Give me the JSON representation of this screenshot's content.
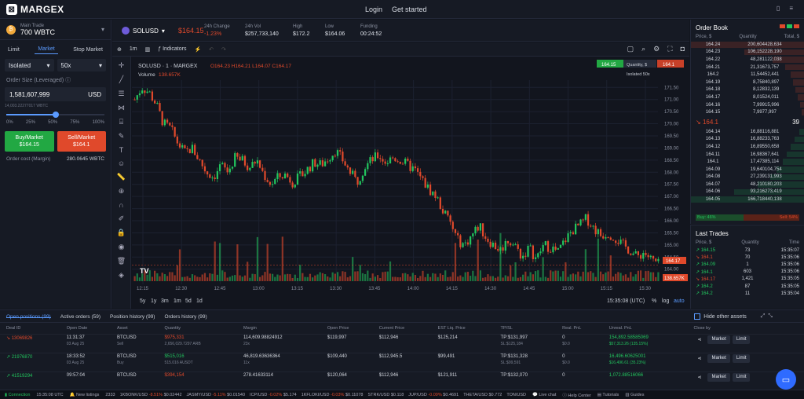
{
  "header": {
    "brand": "MARGEX",
    "login": "Login",
    "get_started": "Get started"
  },
  "account": {
    "label": "Main Trade",
    "value": "700 WBTC"
  },
  "order_form": {
    "tabs": [
      "Limit",
      "Market",
      "Stop Market"
    ],
    "active_tab": "Market",
    "margin_mode": "Isolated",
    "leverage": "50x",
    "size_label": "Order Size (Leveraged)",
    "size_value": "1,581,607,999",
    "size_unit": "USD",
    "size_sub": "14,003.22277017 WBTC",
    "slider_percent": 0.5,
    "slider_marks": [
      "0%",
      "25%",
      "50%",
      "75%",
      "100%"
    ],
    "buy_label": "Buy/Market",
    "buy_price": "$164.15",
    "sell_label": "Sell/Market",
    "sell_price": "$164.1",
    "cost_label": "Order cost (Margin)",
    "cost_value": "280.0645 WBTC"
  },
  "ticker": {
    "symbol": "SOLUSD",
    "last_price": "$164.15",
    "change_label": "24h Change",
    "change_value": "-1.23%",
    "vol_label": "24h Vol",
    "vol_value": "$257,733,140",
    "high_label": "High",
    "high_value": "$172.2",
    "low_label": "Low",
    "low_value": "$164.06",
    "funding_label": "Funding",
    "funding_value": "00:24:52"
  },
  "toolbar": {
    "interval": "1m",
    "indicators": "Indicators"
  },
  "chart_legend": {
    "title": "SOLUSD · 1 · MARGEX",
    "ohlc": "O164.23  H164.21  L164.07  C164.17",
    "volume_label": "Volume",
    "volume_value": "138.657K",
    "buy_tag": "164.15",
    "qty_tag": "Quantity, $",
    "sell_tag": "164.1",
    "isolated_tag": "Isolated 50x",
    "last_price_tag": "164.17",
    "volume_tag": "138.657K",
    "time_ranges": [
      "5y",
      "1y",
      "3m",
      "1m",
      "5d",
      "1d"
    ],
    "clock": "15:35:08 (UTC)",
    "percent": "%",
    "log": "log",
    "auto": "auto"
  },
  "chart_data": {
    "type": "candlestick",
    "x_ticks": [
      "12:15",
      "12:30",
      "12:45",
      "13:00",
      "13:15",
      "13:30",
      "13:45",
      "14:00",
      "14:15",
      "14:30",
      "14:45",
      "15:00",
      "15:15",
      "15:30"
    ],
    "y_ticks": [
      "171.50",
      "171.00",
      "170.50",
      "170.00",
      "169.50",
      "169.00",
      "168.50",
      "168.00",
      "167.50",
      "167.00",
      "166.50",
      "166.00",
      "165.50",
      "165.00",
      "164.50",
      "164.00"
    ],
    "ylim": [
      163.7,
      171.8
    ],
    "close_path": [
      171.0,
      171.5,
      171.3,
      170.8,
      170.0,
      169.8,
      169.2,
      168.8,
      169.0,
      168.5,
      168.0,
      167.8,
      168.3,
      168.0,
      168.6,
      168.5,
      168.2,
      168.5,
      167.9,
      167.5,
      167.8,
      167.9,
      167.6,
      167.8,
      168.1,
      168.4,
      168.3,
      168.6,
      168.9,
      168.5,
      168.0,
      167.6,
      168.2,
      168.5,
      168.7,
      168.4,
      168.6,
      168.5,
      168.3,
      168.1,
      167.7,
      167.3,
      167.0,
      166.4,
      165.9,
      165.2,
      165.0,
      165.4,
      165.8,
      165.3,
      165.0,
      164.8,
      165.2,
      165.0,
      164.5,
      164.9,
      164.4,
      165.0,
      164.9,
      164.7,
      165.2,
      165.6,
      165.8,
      166.1,
      165.7,
      165.4,
      165.5,
      165.3,
      165.0,
      164.8,
      164.5,
      164.7,
      164.4,
      164.2
    ]
  },
  "order_book": {
    "title": "Order Book",
    "headers": [
      "Price, $",
      "Quantity",
      "Total, $"
    ],
    "asks": [
      [
        "164.24",
        "200,604",
        "428,634"
      ],
      [
        "164.23",
        "106,152",
        "228,190"
      ],
      [
        "164.22",
        "48,281",
        "122,038"
      ],
      [
        "164.21",
        "21,316",
        "73,757"
      ],
      [
        "164.2",
        "11,544",
        "52,441"
      ],
      [
        "164.19",
        "8,758",
        "40,897"
      ],
      [
        "164.18",
        "8,128",
        "32,139"
      ],
      [
        "164.17",
        "8,015",
        "24,011"
      ],
      [
        "164.16",
        "7,999",
        "15,996"
      ],
      [
        "164.15",
        "7,997",
        "7,997"
      ]
    ],
    "ask_depth": [
      1,
      0.53,
      0.28,
      0.17,
      0.12,
      0.095,
      0.075,
      0.056,
      0.037,
      0.019
    ],
    "mid_price": "164.1",
    "mid_spread": "39",
    "bids": [
      [
        "164.14",
        "16,881",
        "16,881"
      ],
      [
        "164.13",
        "16,882",
        "33,763"
      ],
      [
        "164.12",
        "16,895",
        "50,658"
      ],
      [
        "164.11",
        "16,983",
        "67,641"
      ],
      [
        "164.1",
        "17,473",
        "85,114"
      ],
      [
        "164.09",
        "19,640",
        "104,754"
      ],
      [
        "164.08",
        "27,239",
        "131,993"
      ],
      [
        "164.07",
        "48,210",
        "180,203"
      ],
      [
        "164.06",
        "93,216",
        "273,419"
      ],
      [
        "164.05",
        "166,718",
        "440,138"
      ]
    ],
    "bid_depth": [
      0.04,
      0.08,
      0.12,
      0.15,
      0.19,
      0.24,
      0.3,
      0.41,
      0.62,
      1
    ],
    "buy_ratio": "Buy: 46%",
    "sell_ratio": "Sell: 54%",
    "buy_share": 0.46
  },
  "last_trades": {
    "title": "Last Trades",
    "headers": [
      "Price, $",
      "Quantity",
      "Time"
    ],
    "rows": [
      [
        "↗ 164.15",
        "73",
        "15:35:07",
        "up"
      ],
      [
        "↘ 164.1",
        "70",
        "15:35:06",
        "down"
      ],
      [
        "↗ 164.09",
        "1",
        "15:35:06",
        "up"
      ],
      [
        "↗ 164.1",
        "603",
        "15:35:06",
        "up"
      ],
      [
        "↘ 164.17",
        "1,421",
        "15:35:05",
        "down"
      ],
      [
        "↗ 164.2",
        "87",
        "15:35:05",
        "up"
      ],
      [
        "↗ 164.2",
        "11",
        "15:35:04",
        "up"
      ]
    ]
  },
  "positions": {
    "tabs": [
      "Open positions (99)",
      "Active orders (59)",
      "Position history (99)",
      "Orders history (99)"
    ],
    "hide_assets": "Hide other assets",
    "headers": [
      "Deal ID",
      "Open Date",
      "Asset",
      "Quantity",
      "Margin",
      "Open Price",
      "Current Price",
      "EST Liq. Price",
      "TP/SL",
      "Real. PnL",
      "Unreal. PnL",
      "Close by"
    ],
    "rows": [
      {
        "dir": "down",
        "id": "13069826",
        "date": "11:31:37",
        "date2": "03 Aug 25",
        "asset": "BTCUSD",
        "side": "Sell",
        "qty": "$975,331",
        "qty2": "2,656,029.7297 ARB",
        "qtycls": "neg",
        "margin": "114,609.98824912",
        "margin2": "23x",
        "open": "$119,997",
        "current": "$112,946",
        "liq": "$125,214",
        "tp": "TP:$131,997",
        "sl": "SL:$125,184",
        "rpnl": "0",
        "rpnl2": "$0.0",
        "upnl": "154,892.58585069",
        "upnl2": "$57,313.26 (135.15%)",
        "upnlcls": "pos"
      },
      {
        "dir": "up",
        "id": "21976870",
        "date": "18:33:52",
        "date2": "03 Aug 25",
        "asset": "BTCUSD",
        "side": "Buy",
        "qty": "$515,016",
        "qty2": "515.016 AUSDT",
        "qtycls": "pos",
        "margin": "46,819.63636364",
        "margin2": "11x",
        "open": "$109,440",
        "current": "$112,945.5",
        "liq": "$99,491",
        "tp": "TP:$131,328",
        "sl": "SL:$99,591",
        "rpnl": "0",
        "rpnl2": "$0.0",
        "upnl": "16,496.60625001",
        "upnl2": "$16,496.61 (35.23%)",
        "upnlcls": "pos"
      },
      {
        "dir": "up",
        "id": "41519294",
        "date": "09:57:04",
        "date2": "",
        "asset": "BTCUSD",
        "side": "",
        "qty": "$394,154",
        "qty2": "",
        "qtycls": "neg",
        "margin": "278.41633114",
        "margin2": "",
        "open": "$120,064",
        "current": "$112,946",
        "liq": "$121,911",
        "tp": "TP:$132,070",
        "sl": "",
        "rpnl": "0",
        "rpnl2": "",
        "upnl": "1,072.88516066",
        "upnl2": "",
        "upnlcls": "pos"
      }
    ],
    "close_market": "Market",
    "close_limit": "Limit"
  },
  "status_bar": {
    "connection": "Connection",
    "time": "15:35:08 UTC",
    "new_listings": "New listings",
    "tickers": [
      [
        "2333",
        "",
        ""
      ],
      [
        "1KBONK/USD",
        "-8.51%",
        "$0.02442"
      ],
      [
        "JASMY/USD",
        "-5.11%",
        "$0.01540"
      ],
      [
        "ICP/USD",
        "-0.02%",
        "$5.174"
      ],
      [
        "1KFLOKI/USD",
        "-0.03%",
        "$0.11078"
      ],
      [
        "STRK/USD",
        "$0.118",
        ""
      ],
      [
        "JUP/USD",
        "-0.09%",
        "$0.4691"
      ],
      [
        "THETA/USD",
        "$0.772",
        ""
      ],
      [
        "TON/USD",
        "",
        ""
      ]
    ],
    "live_chat": "Live chat",
    "help_center": "Help Center",
    "tutorials": "Tutorials",
    "guides": "Guides"
  },
  "colors": {
    "up": "#22c55e",
    "down": "#e0492b",
    "accent": "#5b9bff",
    "bg": "#12151e"
  }
}
